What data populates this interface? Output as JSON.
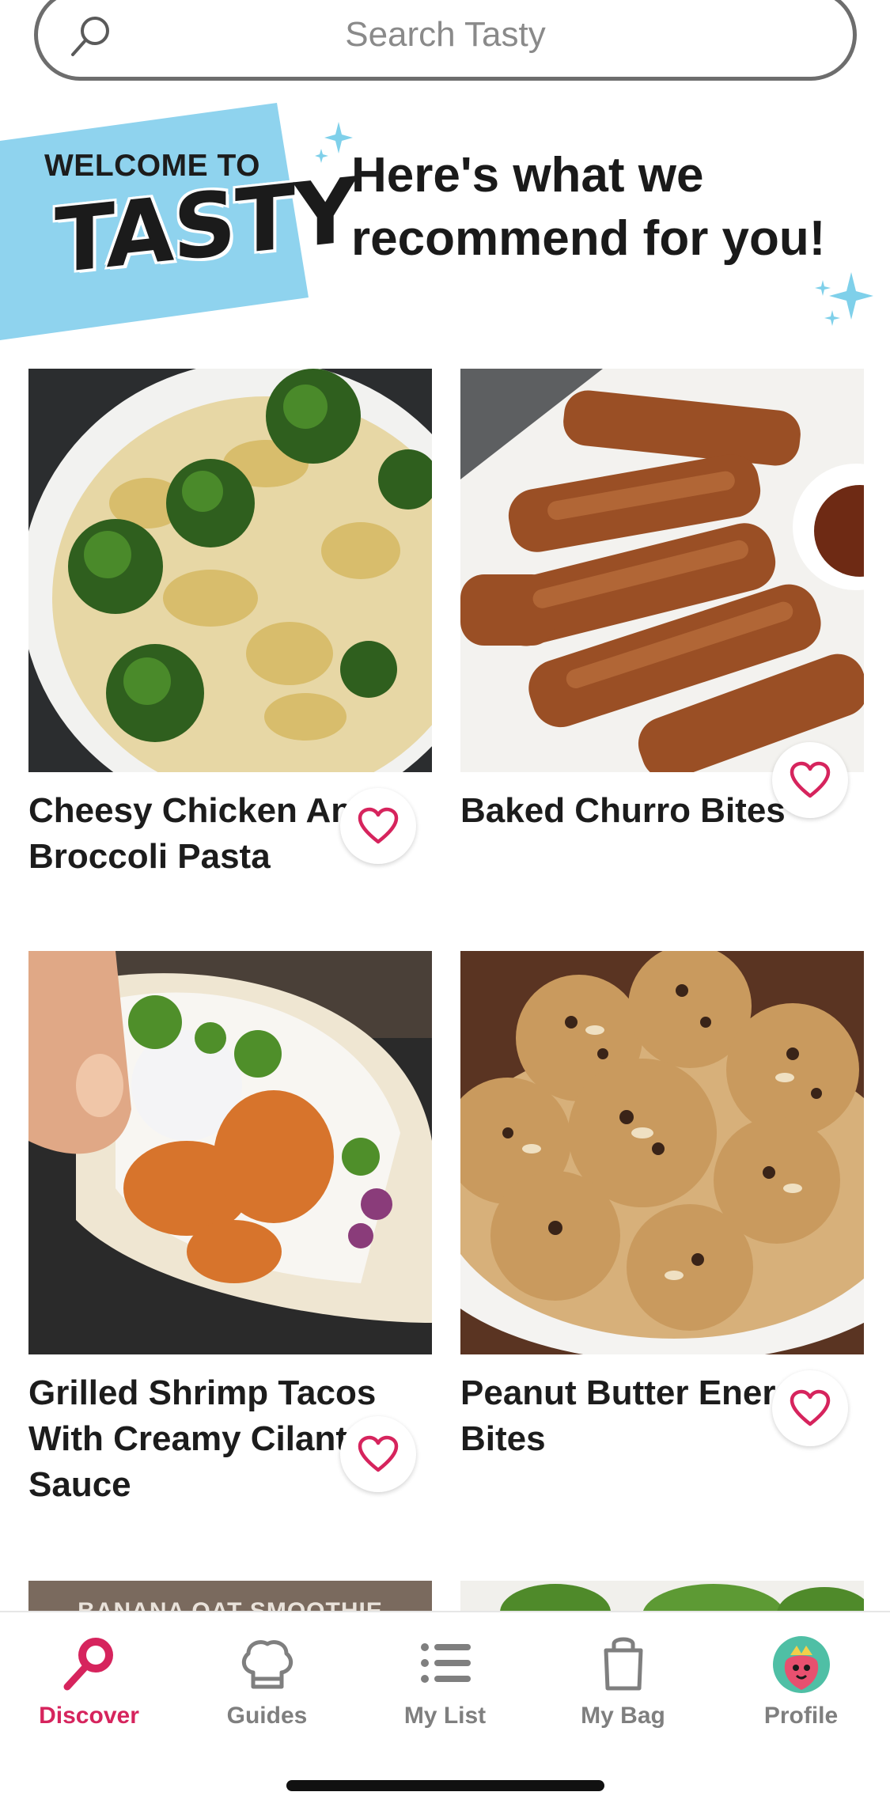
{
  "search": {
    "placeholder": "Search Tasty",
    "icon": "search-icon"
  },
  "welcome": {
    "line1": "WELCOME TO",
    "logo": "TASTY",
    "banner_color": "#8fd3ee"
  },
  "headline": "Here's what we recommend for you!",
  "accent_color": "#d6245d",
  "recipes": [
    {
      "title": "Cheesy Chicken And Broccoli Pasta",
      "favorite_icon": "heart-icon"
    },
    {
      "title": "Baked Churro Bites",
      "favorite_icon": "heart-icon"
    },
    {
      "title": "Grilled Shrimp Tacos With Creamy Cilantro Sauce",
      "favorite_icon": "heart-icon"
    },
    {
      "title": "Peanut Butter Energy Bites",
      "favorite_icon": "heart-icon"
    }
  ],
  "partial_cards": [
    {
      "overlay_text": "BANANA OAT SMOOTHIE"
    }
  ],
  "tabs": [
    {
      "label": "Discover",
      "icon": "search-icon",
      "active": true
    },
    {
      "label": "Guides",
      "icon": "chef-hat-icon",
      "active": false
    },
    {
      "label": "My List",
      "icon": "list-icon",
      "active": false
    },
    {
      "label": "My Bag",
      "icon": "bag-icon",
      "active": false
    },
    {
      "label": "Profile",
      "icon": "strawberry-avatar-icon",
      "active": false
    }
  ]
}
